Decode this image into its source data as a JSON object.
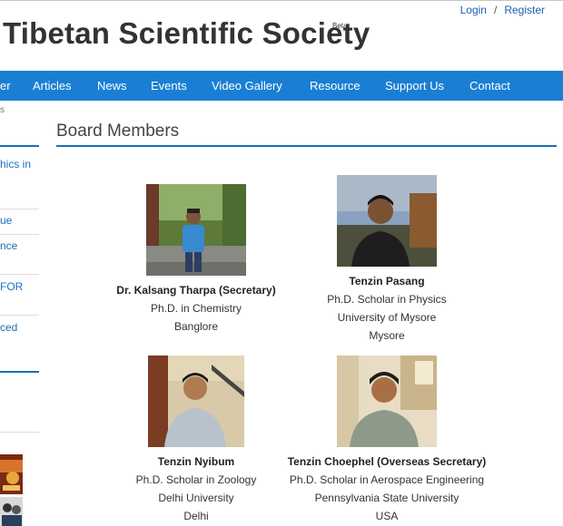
{
  "header": {
    "site_title": "Tibetan Scientific Society",
    "beta_label": "Beta",
    "login": "Login",
    "separator": "/",
    "register": "Register"
  },
  "nav": {
    "items": [
      {
        "label": "er"
      },
      {
        "label": "Articles"
      },
      {
        "label": "News"
      },
      {
        "label": "Events"
      },
      {
        "label": "Video Gallery"
      },
      {
        "label": "Resource"
      },
      {
        "label": "Support Us"
      },
      {
        "label": "Contact"
      }
    ]
  },
  "sidebar": {
    "top_text": "s",
    "items": [
      {
        "label": "hics in"
      },
      {
        "label": "ue"
      },
      {
        "label": "nce"
      },
      {
        "label": "FOR"
      },
      {
        "label": "ced"
      }
    ]
  },
  "main": {
    "section_title": "Board Members",
    "members": [
      {
        "name": "Dr. Kalsang Tharpa (Secretary)",
        "line1": "Ph.D. in Chemistry",
        "line2": "Banglore",
        "line3": ""
      },
      {
        "name": "Tenzin Pasang",
        "line1": "Ph.D. Scholar in Physics",
        "line2": "University of Mysore",
        "line3": "Mysore"
      },
      {
        "name": "Tenzin Nyibum",
        "line1": "Ph.D. Scholar in Zoology",
        "line2": "Delhi University",
        "line3": "Delhi"
      },
      {
        "name": "Tenzin Choephel (Overseas Secretary)",
        "line1": "Ph.D. Scholar in Aerospace Engineering",
        "line2": "Pennsylvania State University",
        "line3": "USA"
      }
    ]
  },
  "colors": {
    "nav_bg": "#1a7fd4",
    "accent": "#1a6fb8",
    "link": "#1a5fa8"
  }
}
